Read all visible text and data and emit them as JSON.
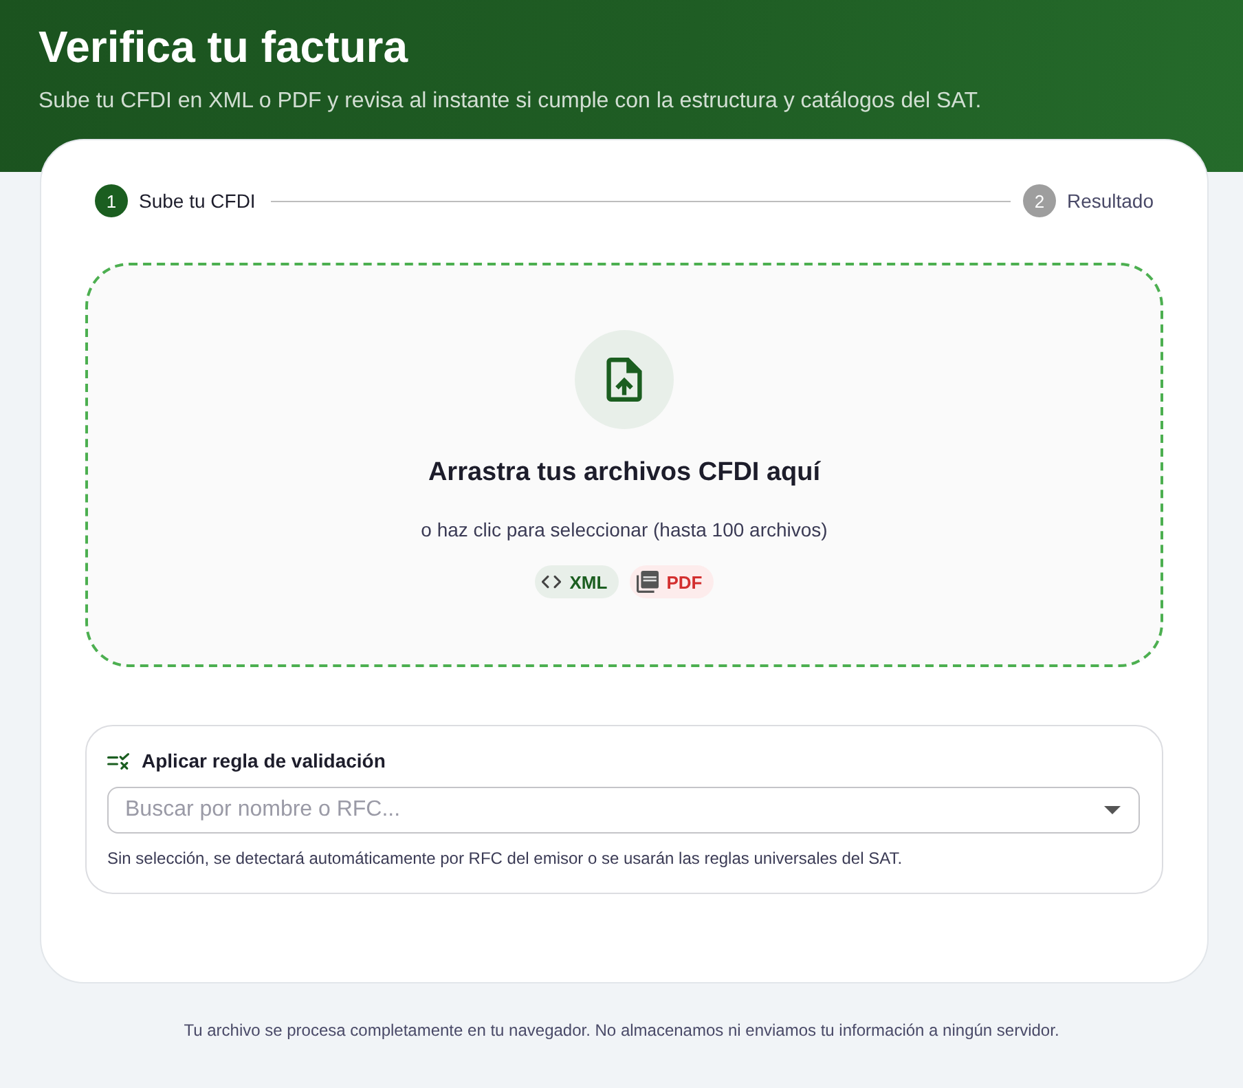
{
  "header": {
    "title": "Verifica tu factura",
    "subtitle": "Sube tu CFDI en XML o PDF y revisa al instante si cumple con la estructura y catálogos del SAT."
  },
  "steps": [
    {
      "number": "1",
      "label": "Sube tu CFDI",
      "selected": true
    },
    {
      "number": "2",
      "label": "Resultado",
      "selected": false
    }
  ],
  "dropzone": {
    "title": "Arrastra tus archivos CFDI aquí",
    "hint": "o haz clic para seleccionar (hasta 100 archivos)",
    "formats": [
      {
        "kind": "xml",
        "label": "XML"
      },
      {
        "kind": "pdf",
        "label": "PDF"
      }
    ]
  },
  "validation_rule": {
    "title": "Aplicar regla de validación",
    "search": {
      "placeholder": "Buscar por nombre o RFC..."
    },
    "helper": "Sin selección, se detectará automáticamente por RFC del emisor o se usarán las reglas universales del SAT."
  },
  "footer": "Tu archivo se procesa completamente en tu navegador. No almacenamos ni enviamos tu información a ningún servidor."
}
